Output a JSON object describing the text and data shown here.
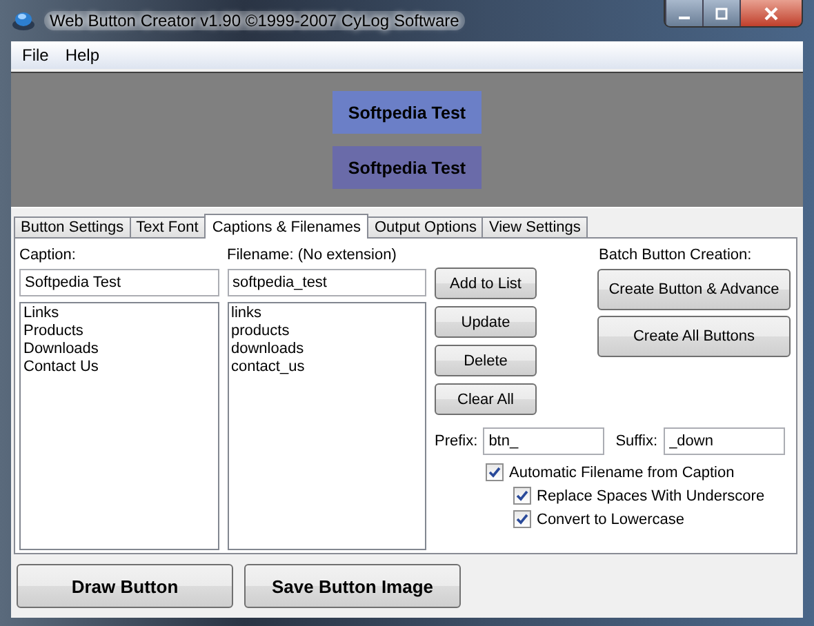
{
  "window": {
    "title": "Web Button Creator v1.90 ©1999-2007 CyLog Software"
  },
  "menu": [
    "File",
    "Help"
  ],
  "preview": {
    "buttons": [
      {
        "label": "Softpedia Test",
        "color": "#6b7fc7"
      },
      {
        "label": "Softpedia Test",
        "color": "#6a6ba9"
      }
    ]
  },
  "tabs": [
    {
      "label": "Button Settings",
      "selected": false
    },
    {
      "label": "Text Font",
      "selected": false
    },
    {
      "label": "Captions & Filenames",
      "selected": true
    },
    {
      "label": "Output Options",
      "selected": false
    },
    {
      "label": "View Settings",
      "selected": false
    }
  ],
  "caption": {
    "label": "Caption:",
    "value": "Softpedia Test",
    "items": [
      "Links",
      "Products",
      "Downloads",
      "Contact Us"
    ]
  },
  "filename": {
    "label": "Filename: (No extension)",
    "value": "softpedia_test",
    "items": [
      "links",
      "products",
      "downloads",
      "contact_us"
    ]
  },
  "actions": [
    "Add to List",
    "Update",
    "Delete",
    "Clear All"
  ],
  "batch": {
    "label": "Batch Button Creation:",
    "buttons": [
      "Create Button & Advance",
      "Create All Buttons"
    ]
  },
  "prefix": {
    "label": "Prefix:",
    "value": "btn_"
  },
  "suffix": {
    "label": "Suffix:",
    "value": "_down"
  },
  "options": [
    {
      "label": "Automatic Filename from Caption",
      "checked": true,
      "children": [
        {
          "label": "Replace Spaces With Underscore",
          "checked": true
        },
        {
          "label": "Convert to Lowercase",
          "checked": true
        }
      ]
    }
  ],
  "bottom_buttons": [
    "Draw Button",
    "Save Button Image"
  ]
}
